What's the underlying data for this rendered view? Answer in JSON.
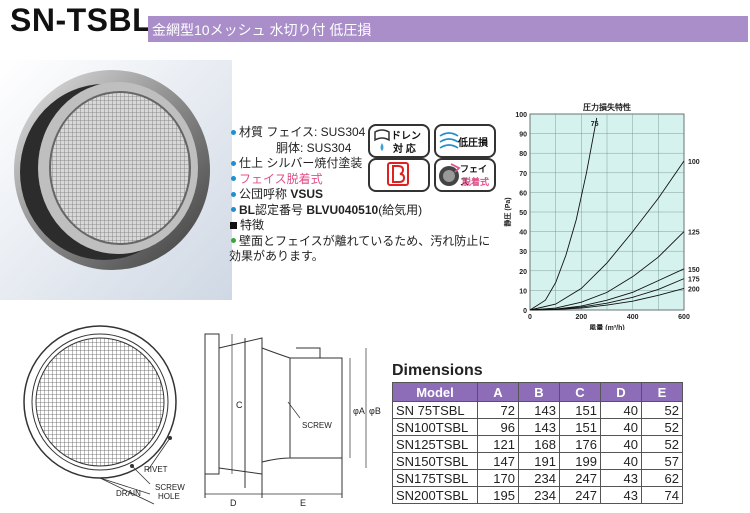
{
  "header": {
    "model": "SN-TSBL",
    "subtitle": "金網型10メッシュ 水切り付 低圧損"
  },
  "specs": {
    "material_face_label": "材質 フェイス: SUS304",
    "material_body_label": "胴体: SUS304",
    "finish": "仕上 シルバー焼付塗装",
    "face_removable": "フェイス脱着式",
    "public_name_prefix": "公団呼称",
    "public_name_value": "VSUS",
    "bl_label": "BL",
    "bl_text_prefix": "認定番号",
    "bl_number": "BLVU040510",
    "bl_suffix": "(給気用)",
    "feature_label": "特徴",
    "feature_text": "壁面とフェイスが離れているため、汚れ防止に効果があります。"
  },
  "badges": {
    "drain_line1": "ドレン",
    "drain_line2": "対 応",
    "low_loss": "低圧損",
    "bl_mark": "B",
    "face_line1": "フェイス",
    "face_line2": "脱着式"
  },
  "chart_data": {
    "type": "line",
    "title": "圧力損失特性",
    "xlabel": "風量 (m³/h)",
    "ylabel": "静圧 (Pa)",
    "xlim": [
      0,
      600
    ],
    "ylim": [
      0,
      100
    ],
    "xticks": [
      0,
      200,
      400,
      600
    ],
    "yticks": [
      0,
      10,
      20,
      30,
      40,
      50,
      60,
      70,
      80,
      90,
      100
    ],
    "grid": true,
    "series": [
      {
        "name": "75",
        "x": [
          0,
          60,
          100,
          140,
          180,
          220,
          260
        ],
        "y": [
          0,
          5,
          14,
          28,
          46,
          70,
          98
        ]
      },
      {
        "name": "100",
        "x": [
          0,
          100,
          200,
          300,
          400,
          500,
          600
        ],
        "y": [
          0,
          3,
          11,
          24,
          40,
          57,
          76
        ]
      },
      {
        "name": "125",
        "x": [
          0,
          100,
          200,
          300,
          400,
          500,
          600
        ],
        "y": [
          0,
          1,
          4,
          9,
          17,
          27,
          40
        ]
      },
      {
        "name": "150",
        "x": [
          0,
          100,
          200,
          300,
          400,
          500,
          600
        ],
        "y": [
          0,
          0.5,
          2,
          5,
          9,
          15,
          21
        ]
      },
      {
        "name": "175",
        "x": [
          0,
          100,
          200,
          300,
          400,
          500,
          600
        ],
        "y": [
          0,
          0.3,
          1.5,
          3.5,
          6.5,
          10.5,
          16
        ]
      },
      {
        "name": "200",
        "x": [
          0,
          100,
          200,
          300,
          400,
          500,
          600
        ],
        "y": [
          0,
          0.2,
          1,
          2.5,
          4.5,
          7.5,
          11
        ]
      }
    ]
  },
  "drawing": {
    "rivet": "RIVET",
    "drain": "DRAIN",
    "screw_hole": "SCREW\nHOLE",
    "screw": "SCREW",
    "label_c": "C",
    "label_a": "φA",
    "label_b": "φB",
    "label_d": "D",
    "label_e": "E"
  },
  "dimensions": {
    "title": "Dimensions",
    "headers": [
      "Model",
      "A",
      "B",
      "C",
      "D",
      "E"
    ],
    "rows": [
      [
        "SN  75TSBL",
        "72",
        "143",
        "151",
        "40",
        "52"
      ],
      [
        "SN100TSBL",
        "96",
        "143",
        "151",
        "40",
        "52"
      ],
      [
        "SN125TSBL",
        "121",
        "168",
        "176",
        "40",
        "52"
      ],
      [
        "SN150TSBL",
        "147",
        "191",
        "199",
        "40",
        "57"
      ],
      [
        "SN175TSBL",
        "170",
        "234",
        "247",
        "43",
        "62"
      ],
      [
        "SN200TSBL",
        "195",
        "234",
        "247",
        "43",
        "74"
      ]
    ]
  },
  "colors": {
    "accent_purple": "#a98ec9",
    "table_header": "#8d6db8",
    "chart_bg": "#d6f2ee",
    "bullet_blue": "#1f8fd0",
    "bullet_green": "#3aa53a",
    "pink_text": "#e0508a"
  }
}
